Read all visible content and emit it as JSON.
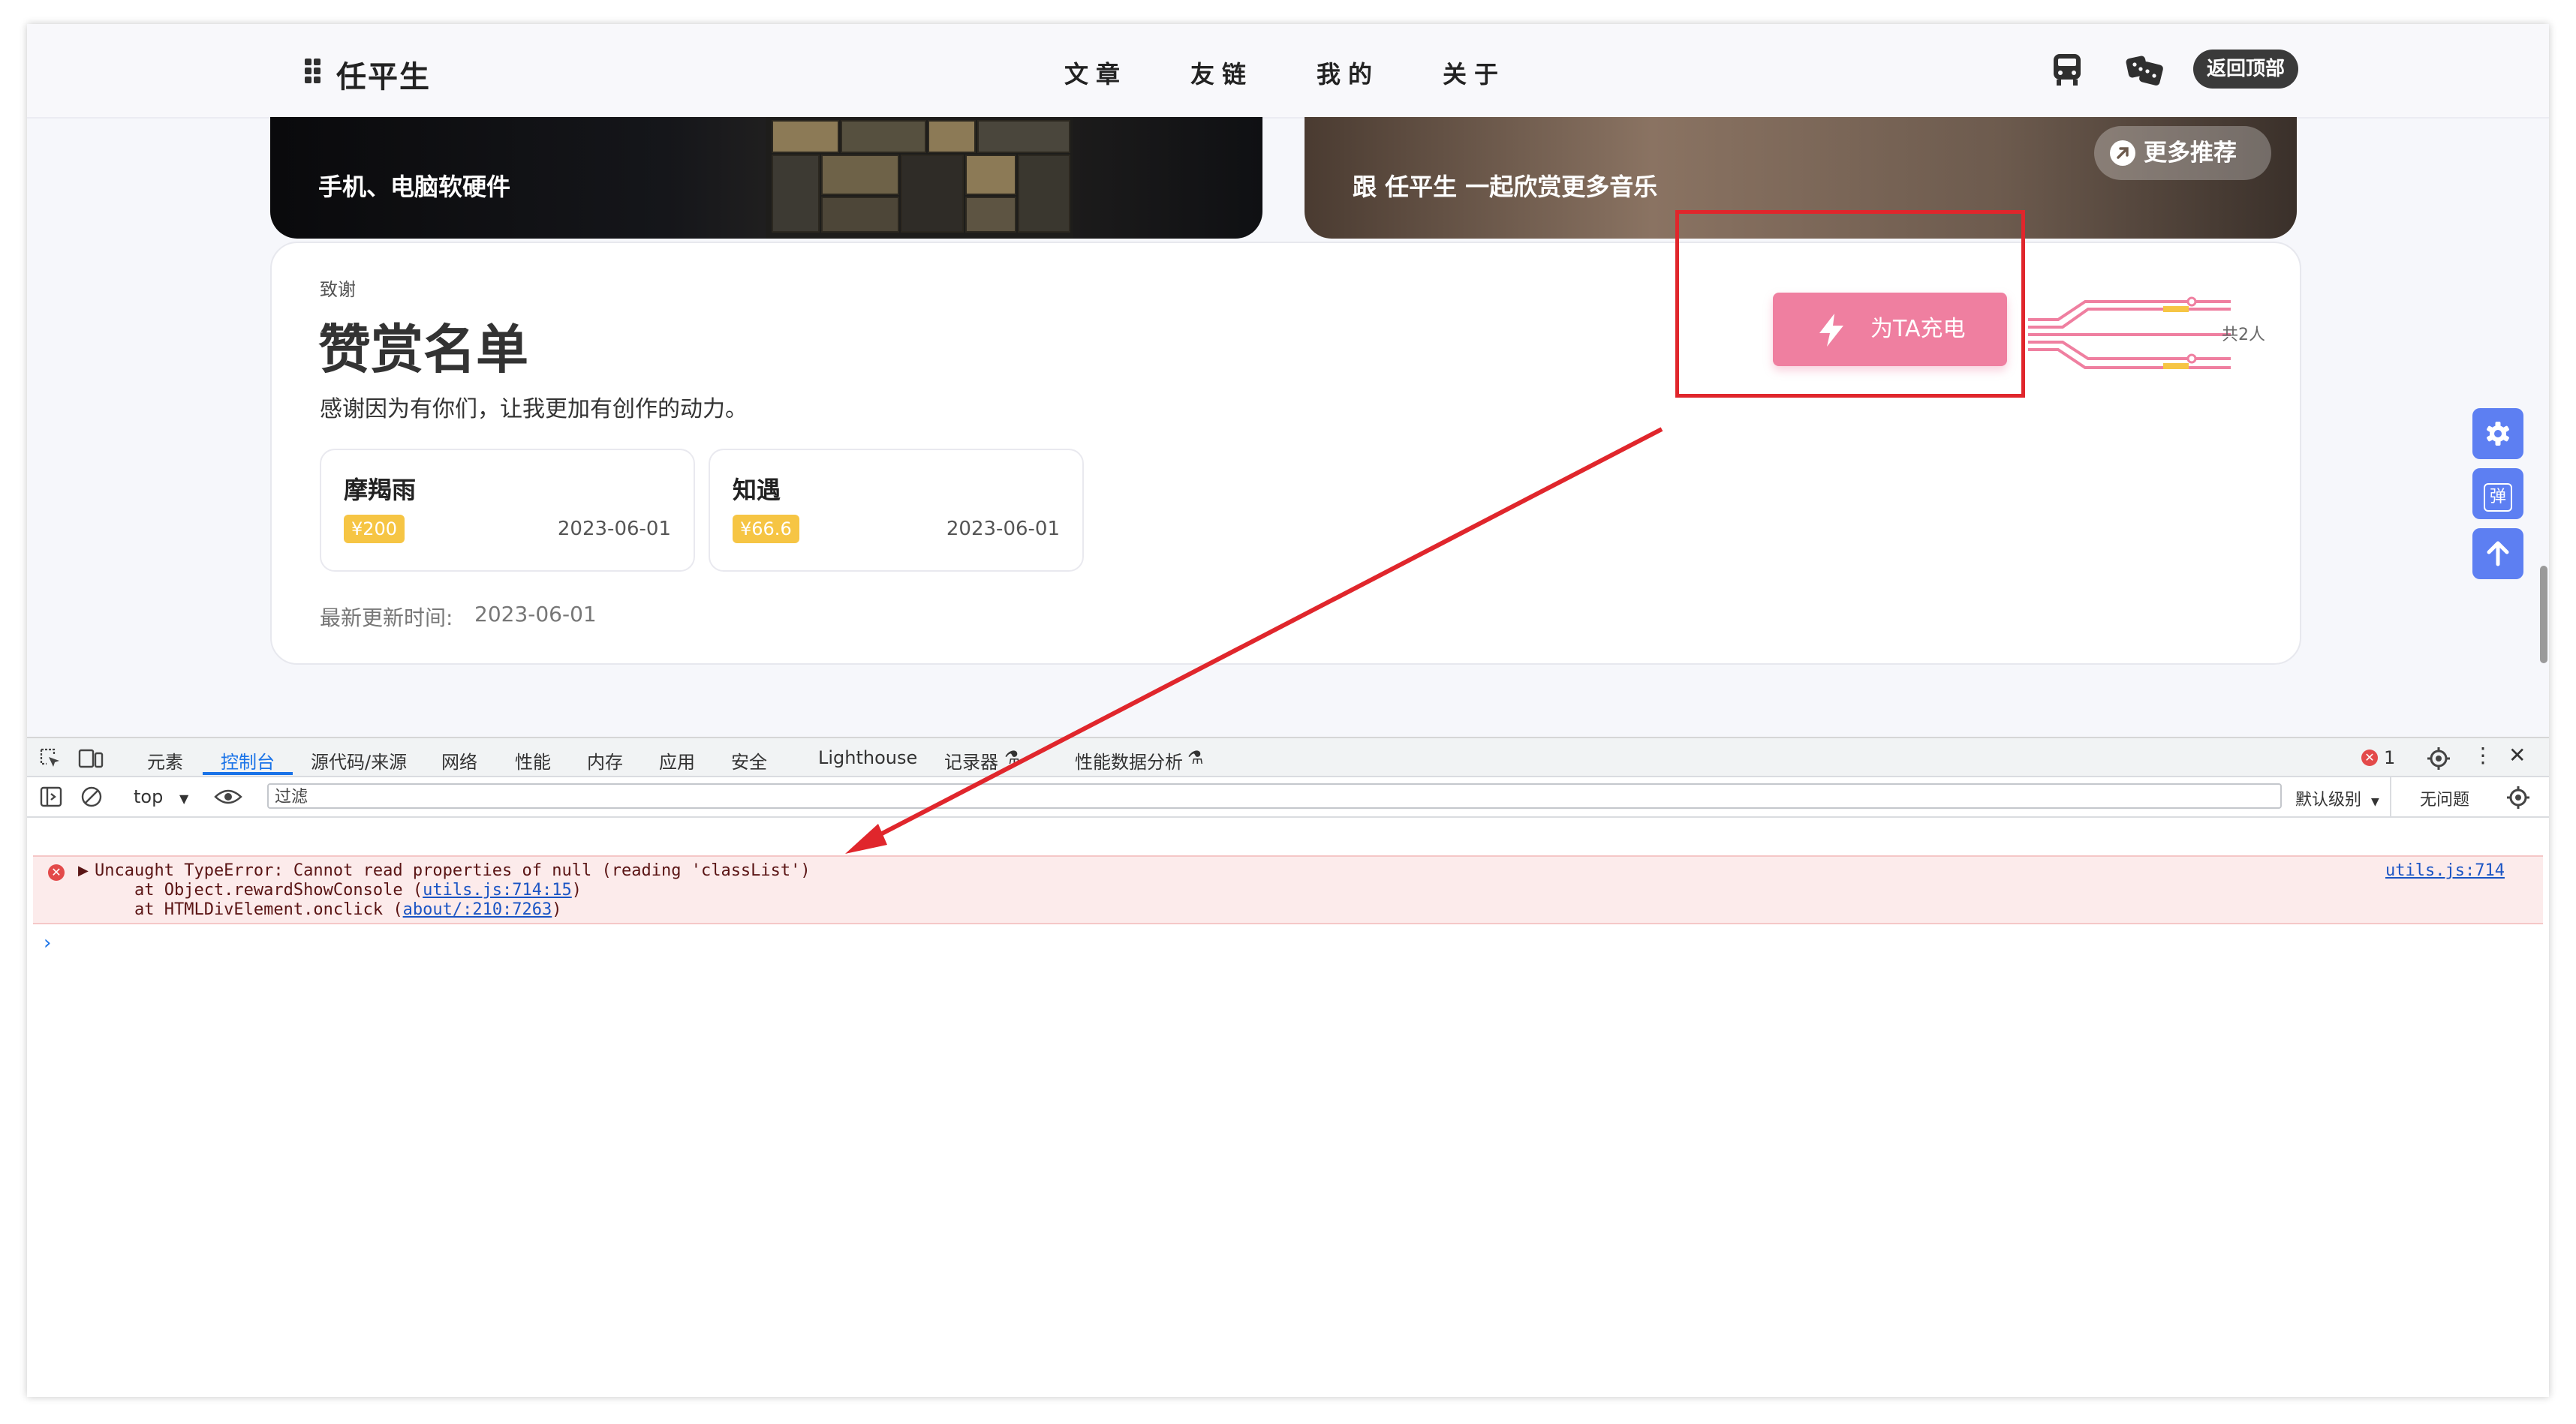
{
  "nav": {
    "site_name": "任平生",
    "links": [
      "文章",
      "友链",
      "我的",
      "关于"
    ],
    "back_top": "返回顶部",
    "icons": [
      "grid-menu-icon",
      "train-icon",
      "dice-icon"
    ]
  },
  "banners": {
    "left_text": "手机、电脑软硬件",
    "right_text": "跟 任平生 一起欣赏更多音乐",
    "more_button": "更多推荐"
  },
  "reward": {
    "tag": "致谢",
    "title": "赞赏名单",
    "description": "感谢因为有你们，让我更加有创作的动力。",
    "donors": [
      {
        "name": "摩羯雨",
        "amount": "¥200",
        "date": "2023-06-01"
      },
      {
        "name": "知遇",
        "amount": "¥66.6",
        "date": "2023-06-01"
      }
    ],
    "updated_label": "最新更新时间:",
    "updated_value": "2023-06-01",
    "charge_button": "为TA充电",
    "count": "共2人"
  },
  "side_buttons": {
    "settings_icon": "gear-icon",
    "danmaku": "弹",
    "up_icon": "arrow-up-icon"
  },
  "devtools": {
    "tabs": [
      "元素",
      "控制台",
      "源代码/来源",
      "网络",
      "性能",
      "内存",
      "应用",
      "安全",
      "Lighthouse",
      "记录器",
      "性能数据分析"
    ],
    "active_tab": "控制台",
    "error_count": "1",
    "context": "top",
    "filter_placeholder": "过滤",
    "levels": "默认级别",
    "issues": "无问题",
    "error": {
      "line1": "Uncaught TypeError: Cannot read properties of null (reading 'classList')",
      "line2_prefix": "    at Object.rewardShowConsole (",
      "line2_link": "utils.js:714:15",
      "line3_prefix": "    at HTMLDivElement.onclick (",
      "line3_link": "about/:210:7263",
      "source": "utils.js:714"
    },
    "prompt": "›"
  },
  "colors": {
    "accent_pink": "#ef7fa0",
    "annotation_red": "#e0262c",
    "float_blue": "#5d7ff2",
    "devtools_blue": "#1a73e8"
  }
}
